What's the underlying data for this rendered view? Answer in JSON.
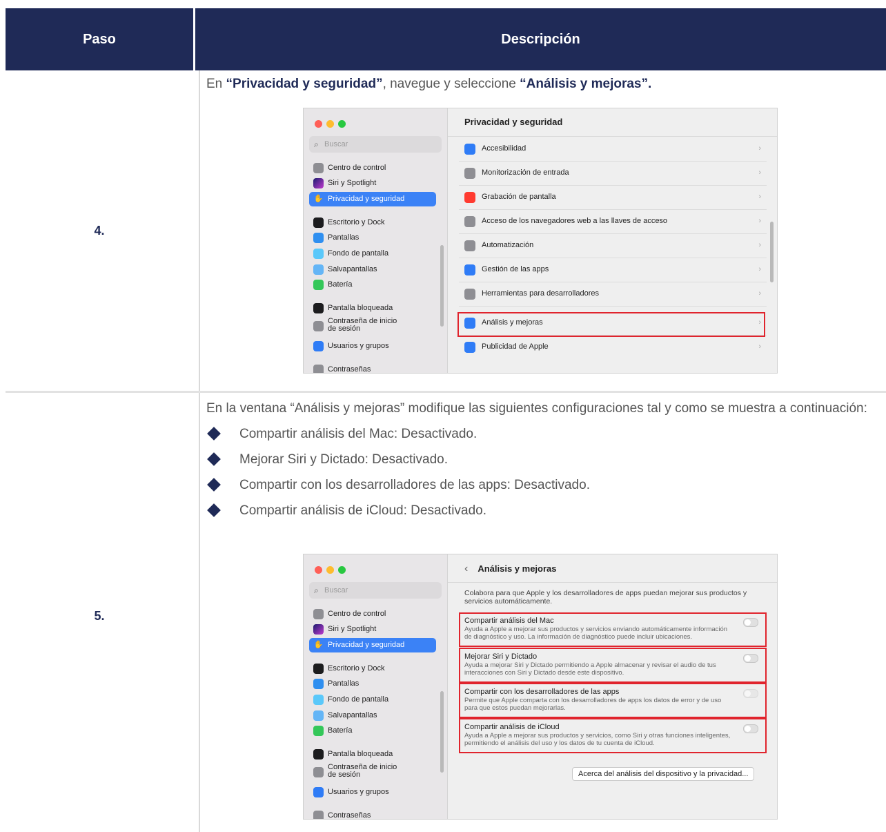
{
  "header": {
    "col_step": "Paso",
    "col_desc": "Descripción"
  },
  "step4": {
    "number": "4.",
    "text_prefix": "En ",
    "text_bold1": "“Privacidad y seguridad”",
    "text_mid": ", navegue y seleccione ",
    "text_bold2": "“Análisis y mejoras”."
  },
  "step5": {
    "number": "5.",
    "paragraph": "En la ventana “Análisis y mejoras” modifique las siguientes configuraciones tal y como se muestra a continuación:",
    "bullets": [
      "Compartir análisis del Mac: Desactivado.",
      "Mejorar Siri y Dictado: Desactivado.",
      "Compartir con los desarrolladores de las apps: Desactivado.",
      "Compartir análisis de iCloud: Desactivado."
    ]
  },
  "sidebar": {
    "search_placeholder": "Buscar",
    "items": [
      {
        "label": "Centro de control",
        "color": "#8e8e93"
      },
      {
        "label": "Siri y Spotlight",
        "color": "#5856d6"
      },
      {
        "label": "Privacidad y seguridad",
        "color": "#3b82f6"
      },
      {
        "label": "Escritorio y Dock",
        "color": "#1c1c1e"
      },
      {
        "label": "Pantallas",
        "color": "#2f8ff0"
      },
      {
        "label": "Fondo de pantalla",
        "color": "#5ac8fa"
      },
      {
        "label": "Salvapantallas",
        "color": "#64b5f6"
      },
      {
        "label": "Batería",
        "color": "#34c759"
      },
      {
        "label": "Pantalla bloqueada",
        "color": "#1c1c1e"
      },
      {
        "label": "Contraseña de inicio",
        "label2": "de sesión",
        "color": "#8e8e93"
      },
      {
        "label": "Usuarios y grupos",
        "color": "#2f7cf6"
      },
      {
        "label": "Contraseñas",
        "color": "#8e8e93"
      }
    ]
  },
  "privacy_window": {
    "title": "Privacidad y seguridad",
    "rows": [
      {
        "label": "Accesibilidad",
        "color": "#2f7cf6"
      },
      {
        "label": "Monitorización de entrada",
        "color": "#8e8e93"
      },
      {
        "label": "Grabación de pantalla",
        "color": "#ff3b30"
      },
      {
        "label": "Acceso de los navegadores web a las llaves de acceso",
        "color": "#8e8e93"
      },
      {
        "label": "Automatización",
        "color": "#8e8e93"
      },
      {
        "label": "Gestión de las apps",
        "color": "#2f7cf6"
      },
      {
        "label": "Herramientas para desarrolladores",
        "color": "#8e8e93"
      },
      {
        "label": "Análisis y mejoras",
        "color": "#2f7cf6"
      },
      {
        "label": "Publicidad de Apple",
        "color": "#2f7cf6"
      }
    ]
  },
  "analysis_window": {
    "title": "Análisis y mejoras",
    "intro": "Colabora para que Apple y los desarrolladores de apps puedan mejorar sus productos y servicios automáticamente.",
    "settings": [
      {
        "title": "Compartir análisis del Mac",
        "desc": "Ayuda a Apple a mejorar sus productos y servicios enviando automáticamente información de diagnóstico y uso. La información de diagnóstico puede incluir ubicaciones."
      },
      {
        "title": "Mejorar Siri y Dictado",
        "desc": "Ayuda a mejorar Siri y Dictado permitiendo a Apple almacenar y revisar el audio de tus interacciones con Siri y Dictado desde este dispositivo."
      },
      {
        "title": "Compartir con los desarrolladores de las apps",
        "desc": "Permite que Apple comparta con los desarrolladores de apps los datos de error y de uso para que estos puedan mejorarlas."
      },
      {
        "title": "Compartir análisis de iCloud",
        "desc": "Ayuda a Apple a mejorar sus productos y servicios, como Siri y otras funciones inteligentes, permitiendo el análisis del uso y los datos de tu cuenta de iCloud."
      }
    ],
    "about_button": "Acerca del análisis del dispositivo y la privacidad..."
  },
  "colors": {
    "header_bg": "#1f2a57",
    "highlight": "#e0242d",
    "selection": "#3b82f6"
  }
}
